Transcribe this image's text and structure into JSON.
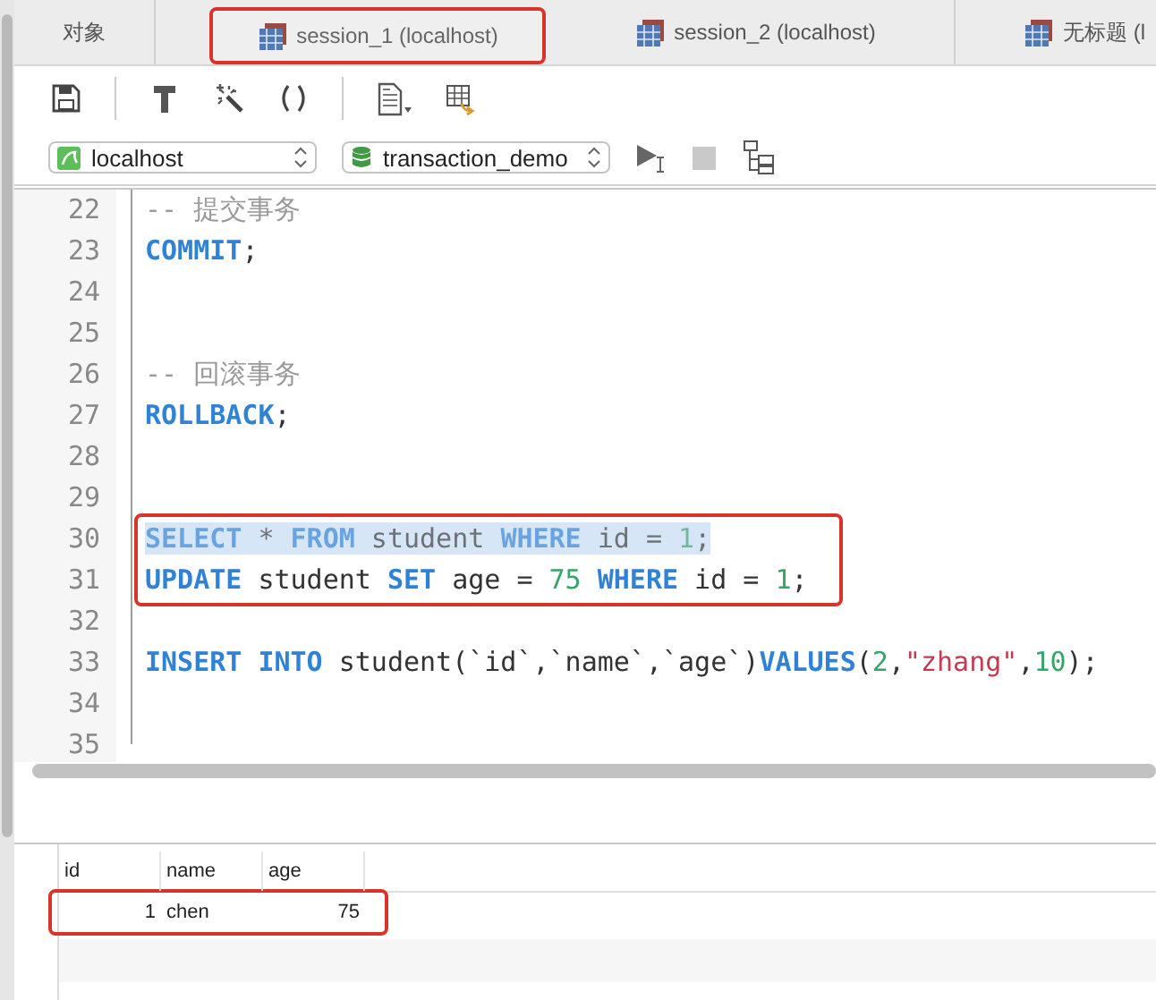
{
  "tabs": [
    {
      "label": "对象",
      "kind": "objects",
      "selected": false,
      "annotated": false
    },
    {
      "label": "session_1 (localhost)",
      "kind": "query",
      "selected": true,
      "annotated": true
    },
    {
      "label": "session_2 (localhost)",
      "kind": "query",
      "selected": false,
      "annotated": false
    },
    {
      "label": "无标题 (l",
      "kind": "query",
      "selected": false,
      "annotated": false
    }
  ],
  "toolbar": [
    {
      "kind": "save"
    },
    {
      "kind": "divider"
    },
    {
      "kind": "hammer"
    },
    {
      "kind": "wand"
    },
    {
      "kind": "parens"
    },
    {
      "kind": "divider"
    },
    {
      "kind": "document"
    },
    {
      "kind": "export"
    }
  ],
  "connection": {
    "server": "localhost",
    "database": "transaction_demo"
  },
  "editor": {
    "lines": [
      {
        "number": "22",
        "tokens": [
          {
            "kind": "comment",
            "text": "-- 提交事务"
          }
        ]
      },
      {
        "number": "23",
        "tokens": [
          {
            "kind": "keyword",
            "text": "COMMIT"
          },
          {
            "kind": "plain",
            "text": ";"
          }
        ]
      },
      {
        "number": "24"
      },
      {
        "number": "25"
      },
      {
        "number": "26",
        "tokens": [
          {
            "kind": "comment",
            "text": "-- 回滚事务"
          }
        ]
      },
      {
        "number": "27",
        "tokens": [
          {
            "kind": "keyword",
            "text": "ROLLBACK"
          },
          {
            "kind": "plain",
            "text": ";"
          }
        ]
      },
      {
        "number": "28"
      },
      {
        "number": "29"
      },
      {
        "number": "30",
        "selected": true,
        "annotated": true,
        "tokens": [
          {
            "kind": "keyword",
            "text": "SELECT"
          },
          {
            "kind": "plain",
            "text": " * "
          },
          {
            "kind": "keyword",
            "text": "FROM"
          },
          {
            "kind": "plain",
            "text": " student "
          },
          {
            "kind": "keyword",
            "text": "WHERE"
          },
          {
            "kind": "plain",
            "text": " id = "
          },
          {
            "kind": "number",
            "text": "1"
          },
          {
            "kind": "plain",
            "text": ";"
          }
        ]
      },
      {
        "number": "31",
        "selected": false,
        "annotated": true,
        "tokens": [
          {
            "kind": "keyword",
            "text": "UPDATE"
          },
          {
            "kind": "plain",
            "text": " student "
          },
          {
            "kind": "keyword",
            "text": "SET"
          },
          {
            "kind": "plain",
            "text": " age = "
          },
          {
            "kind": "number",
            "text": "75"
          },
          {
            "kind": "keyword",
            "text": " WHERE"
          },
          {
            "kind": "plain",
            "text": " id = "
          },
          {
            "kind": "number",
            "text": "1"
          },
          {
            "kind": "plain",
            "text": ";"
          }
        ]
      },
      {
        "number": "32"
      },
      {
        "number": "33",
        "tokens": [
          {
            "kind": "keyword",
            "text": "INSERT INTO"
          },
          {
            "kind": "plain",
            "text": " student(`id`,`name`,`age`)"
          },
          {
            "kind": "keyword",
            "text": "VALUES"
          },
          {
            "kind": "plain",
            "text": "("
          },
          {
            "kind": "number",
            "text": "2"
          },
          {
            "kind": "plain",
            "text": ","
          },
          {
            "kind": "string",
            "text": "\"zhang\""
          },
          {
            "kind": "plain",
            "text": ","
          },
          {
            "kind": "number",
            "text": "10"
          },
          {
            "kind": "plain",
            "text": ");"
          }
        ]
      },
      {
        "number": "34"
      },
      {
        "number": "35"
      }
    ]
  },
  "results": {
    "columns": [
      "id",
      "name",
      "age"
    ],
    "rows": [
      {
        "annotated": true,
        "cells": [
          "1",
          "chen",
          "75"
        ]
      }
    ]
  }
}
